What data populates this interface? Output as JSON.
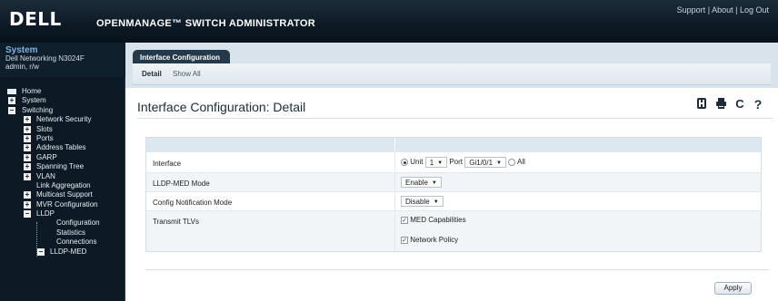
{
  "header": {
    "logo": "DELL",
    "app_title": "OPENMANAGE™ SWITCH ADMINISTRATOR",
    "links": [
      "Support",
      "About",
      "Log Out"
    ],
    "separator": "|"
  },
  "sidebar": {
    "system_title": "System",
    "model": "Dell Networking N3024F",
    "user": "admin, r/w",
    "nav": [
      {
        "label": "Home",
        "level": 0,
        "icon": "home-icon"
      },
      {
        "label": "System",
        "level": 0,
        "icon": "plus-icon"
      },
      {
        "label": "Switching",
        "level": 0,
        "icon": "minus-icon"
      },
      {
        "label": "Network Security",
        "level": 1,
        "icon": "plus-icon"
      },
      {
        "label": "Slots",
        "level": 1,
        "icon": "plus-icon"
      },
      {
        "label": "Ports",
        "level": 1,
        "icon": "plus-icon"
      },
      {
        "label": "Address Tables",
        "level": 1,
        "icon": "plus-icon"
      },
      {
        "label": "GARP",
        "level": 1,
        "icon": "plus-icon"
      },
      {
        "label": "Spanning Tree",
        "level": 1,
        "icon": "plus-icon"
      },
      {
        "label": "VLAN",
        "level": 1,
        "icon": "plus-icon"
      },
      {
        "label": "Link Aggregation",
        "level": 1,
        "icon": "none"
      },
      {
        "label": "Multicast Support",
        "level": 1,
        "icon": "plus-icon"
      },
      {
        "label": "MVR Configuration",
        "level": 1,
        "icon": "plus-icon"
      },
      {
        "label": "LLDP",
        "level": 1,
        "icon": "minus-icon"
      },
      {
        "label": "Configuration",
        "level": 2,
        "icon": "none"
      },
      {
        "label": "Statistics",
        "level": 2,
        "icon": "none"
      },
      {
        "label": "Connections",
        "level": 2,
        "icon": "none"
      },
      {
        "label": "LLDP-MED",
        "level": 2,
        "icon": "minus-icon"
      }
    ]
  },
  "tabs": {
    "main": "Interface Configuration",
    "sub": [
      "Detail",
      "Show All"
    ]
  },
  "page": {
    "title": "Interface Configuration: Detail",
    "icons": [
      "save-icon",
      "print-icon",
      "refresh-icon",
      "help-icon"
    ],
    "refresh_glyph": "C",
    "help_glyph": "?"
  },
  "form": {
    "interface": {
      "label": "Interface",
      "unit_label": "Unit",
      "unit_value": "1",
      "port_label": "Port",
      "port_value": "Gi1/0/1",
      "all_label": "All",
      "selected": "unit"
    },
    "lldp_med_mode": {
      "label": "LLDP-MED Mode",
      "value": "Enable"
    },
    "config_notification_mode": {
      "label": "Config Notification Mode",
      "value": "Disable"
    },
    "transmit_tlvs": {
      "label": "Transmit TLVs",
      "options": [
        {
          "label": "MED Capabilities",
          "checked": true
        },
        {
          "label": "Network Policy",
          "checked": true
        }
      ]
    }
  },
  "buttons": {
    "apply": "Apply"
  }
}
